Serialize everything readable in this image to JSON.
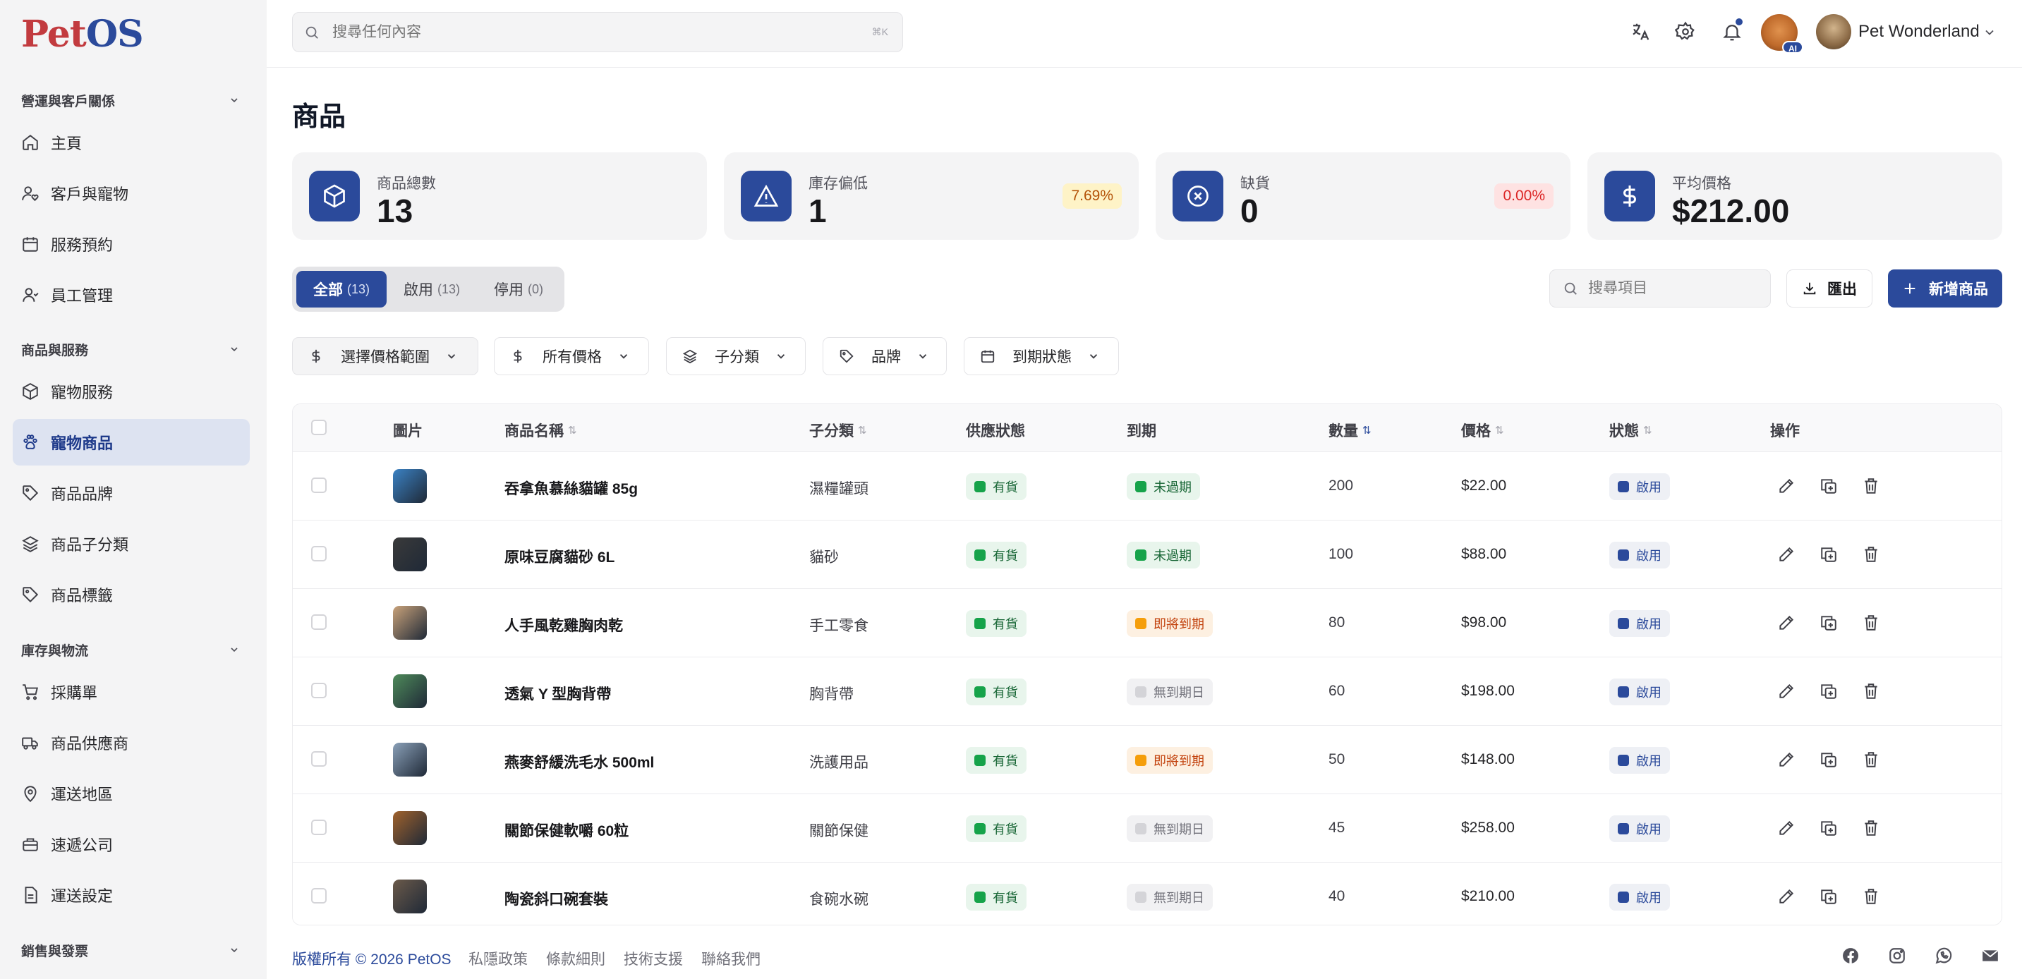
{
  "brand": {
    "logo_part1": "Pet",
    "logo_part2": "OS"
  },
  "sidebar": {
    "sections": [
      {
        "title": "營運與客戶關係"
      },
      {
        "title": "商品與服務"
      },
      {
        "title": "庫存與物流"
      },
      {
        "title": "銷售與發票"
      }
    ],
    "items": [
      {
        "label": "主頁",
        "icon": "home-icon"
      },
      {
        "label": "客戶與寵物",
        "icon": "user-heart-icon"
      },
      {
        "label": "服務預約",
        "icon": "calendar-icon"
      },
      {
        "label": "員工管理",
        "icon": "user-icon"
      },
      {
        "label": "寵物服務",
        "icon": "box-icon"
      },
      {
        "label": "寵物商品",
        "icon": "paw-icon",
        "active": true
      },
      {
        "label": "商品品牌",
        "icon": "tag-icon"
      },
      {
        "label": "商品子分類",
        "icon": "layers-icon"
      },
      {
        "label": "商品標籤",
        "icon": "tag-icon"
      },
      {
        "label": "採購單",
        "icon": "cart-icon"
      },
      {
        "label": "商品供應商",
        "icon": "truck-icon"
      },
      {
        "label": "運送地區",
        "icon": "map-pin-icon"
      },
      {
        "label": "速遞公司",
        "icon": "briefcase-icon"
      },
      {
        "label": "運送設定",
        "icon": "file-icon"
      }
    ]
  },
  "header": {
    "search_placeholder": "搜尋任何內容",
    "search_shortcut": "⌘K",
    "ai_badge": "AI",
    "user_name": "Pet Wonderland",
    "accent": "#2b4a9b"
  },
  "page": {
    "title": "商品"
  },
  "stats": [
    {
      "label": "商品總數",
      "value": "13",
      "icon": "cube-icon"
    },
    {
      "label": "庫存偏低",
      "value": "1",
      "percent": "7.69%",
      "icon": "warning-icon"
    },
    {
      "label": "缺貨",
      "value": "0",
      "percent": "0.00%",
      "icon": "x-circle-icon"
    },
    {
      "label": "平均價格",
      "value": "$212.00",
      "icon": "dollar-icon"
    }
  ],
  "tabs": [
    {
      "label": "全部",
      "count": "(13)"
    },
    {
      "label": "啟用",
      "count": "(13)"
    },
    {
      "label": "停用",
      "count": "(0)"
    }
  ],
  "toolbar": {
    "search_placeholder": "搜尋項目",
    "export_label": "匯出",
    "add_label": "新增商品"
  },
  "filters": [
    {
      "label": "選擇價格範圍",
      "icon": "dollar-icon"
    },
    {
      "label": "所有價格",
      "icon": "dollar-icon"
    },
    {
      "label": "子分類",
      "icon": "layers-icon"
    },
    {
      "label": "品牌",
      "icon": "tag-icon"
    },
    {
      "label": "到期狀態",
      "icon": "calendar-icon"
    }
  ],
  "table": {
    "columns": {
      "image": "圖片",
      "name": "商品名稱",
      "subcategory": "子分類",
      "supply": "供應狀態",
      "expiry": "到期",
      "qty": "數量",
      "price": "價格",
      "status": "狀態",
      "actions": "操作"
    },
    "rows": [
      {
        "name": "吞拿魚慕絲貓罐 85g",
        "subcategory": "濕糧罐頭",
        "supply": "有貨",
        "expiry": "未過期",
        "expiry_tone": "green",
        "qty": "200",
        "price": "$22.00",
        "status": "啟用",
        "thumb_color": "#3b82c4"
      },
      {
        "name": "原味豆腐貓砂 6L",
        "subcategory": "貓砂",
        "supply": "有貨",
        "expiry": "未過期",
        "expiry_tone": "green",
        "qty": "100",
        "price": "$88.00",
        "status": "啟用",
        "thumb_color": "#3a3a3a"
      },
      {
        "name": "人手風乾雞胸肉乾",
        "subcategory": "手工零食",
        "supply": "有貨",
        "expiry": "即將到期",
        "expiry_tone": "orange",
        "qty": "80",
        "price": "$98.00",
        "status": "啟用",
        "thumb_color": "#c9a27a"
      },
      {
        "name": "透氣 Y 型胸背帶",
        "subcategory": "胸背帶",
        "supply": "有貨",
        "expiry": "無到期日",
        "expiry_tone": "gray",
        "qty": "60",
        "price": "$198.00",
        "status": "啟用",
        "thumb_color": "#4e8a5a"
      },
      {
        "name": "燕麥舒緩洗毛水 500ml",
        "subcategory": "洗護用品",
        "supply": "有貨",
        "expiry": "即將到期",
        "expiry_tone": "orange",
        "qty": "50",
        "price": "$148.00",
        "status": "啟用",
        "thumb_color": "#8aa0b8"
      },
      {
        "name": "關節保健軟嚼 60粒",
        "subcategory": "關節保健",
        "supply": "有貨",
        "expiry": "無到期日",
        "expiry_tone": "gray",
        "qty": "45",
        "price": "$258.00",
        "status": "啟用",
        "thumb_color": "#a0622c"
      },
      {
        "name": "陶瓷斜口碗套裝",
        "subcategory": "食碗水碗",
        "supply": "有貨",
        "expiry": "無到期日",
        "expiry_tone": "gray",
        "qty": "40",
        "price": "$210.00",
        "status": "啟用",
        "thumb_color": "#6b5a4a"
      }
    ]
  },
  "footer": {
    "copyright": "版權所有 © 2026 PetOS",
    "links": [
      "私隱政策",
      "條款細則",
      "技術支援",
      "聯絡我們"
    ],
    "socials": [
      "facebook-icon",
      "instagram-icon",
      "whatsapp-icon",
      "mail-icon"
    ]
  }
}
